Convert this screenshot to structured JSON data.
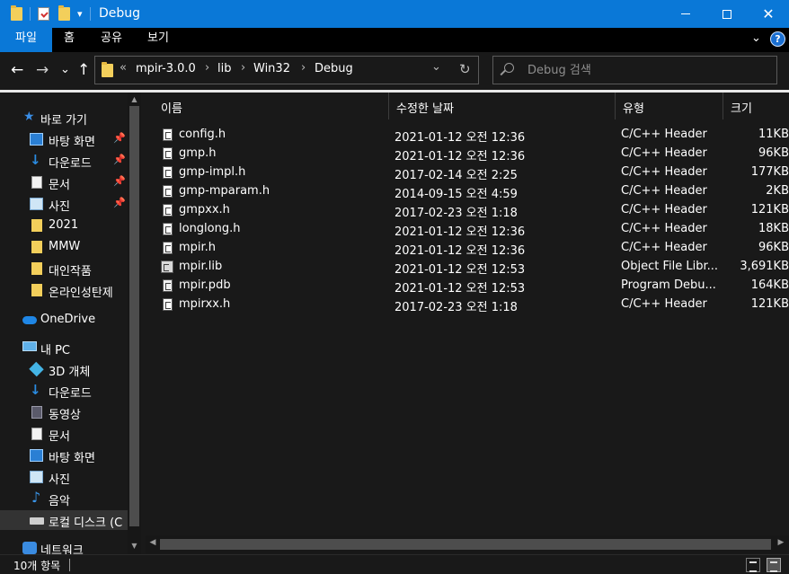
{
  "window": {
    "title": "Debug",
    "minimize_glyph": "—",
    "maximize_glyph": "☐",
    "close_glyph": "✕"
  },
  "ribbon": {
    "tabs": [
      "파일",
      "홈",
      "공유",
      "보기"
    ],
    "collapse_glyph": "⌄",
    "help_glyph": "?"
  },
  "address": {
    "overflow": "«",
    "crumbs": [
      "mpir-3.0.0",
      "lib",
      "Win32",
      "Debug"
    ],
    "separator": "›",
    "dropdown_glyph": "⌄",
    "refresh_glyph": "↻"
  },
  "nav_buttons": {
    "back": "←",
    "forward": "→",
    "recent": "⌄",
    "up": "↑"
  },
  "search": {
    "placeholder": "Debug 검색"
  },
  "navpane": {
    "items": [
      {
        "label": "바로 가기",
        "icon": "star-icon"
      },
      {
        "label": "바탕 화면",
        "icon": "desktop-icon",
        "pinned": true
      },
      {
        "label": "다운로드",
        "icon": "download-icon",
        "pinned": true
      },
      {
        "label": "문서",
        "icon": "document-icon",
        "pinned": true
      },
      {
        "label": "사진",
        "icon": "picture-icon",
        "pinned": true
      },
      {
        "label": "2021",
        "icon": "folder-icon"
      },
      {
        "label": "MMW",
        "icon": "folder-icon"
      },
      {
        "label": "대인작품",
        "icon": "folder-icon"
      },
      {
        "label": "온라인성탄제",
        "icon": "folder-icon"
      },
      {
        "label": "OneDrive",
        "icon": "cloud-icon"
      },
      {
        "label": "내 PC",
        "icon": "computer-icon"
      },
      {
        "label": "3D 개체",
        "icon": "3d-objects-icon"
      },
      {
        "label": "다운로드",
        "icon": "download-icon"
      },
      {
        "label": "동영상",
        "icon": "video-icon"
      },
      {
        "label": "문서",
        "icon": "document-icon"
      },
      {
        "label": "바탕 화면",
        "icon": "desktop-icon"
      },
      {
        "label": "사진",
        "icon": "picture-icon"
      },
      {
        "label": "음악",
        "icon": "music-icon"
      },
      {
        "label": "로컬 디스크 (C",
        "icon": "drive-icon"
      },
      {
        "label": "네트워크",
        "icon": "network-icon"
      }
    ],
    "pin_glyph": "📌"
  },
  "columns": {
    "name": "이름",
    "date": "수정한 날짜",
    "type": "유형",
    "size": "크기",
    "sort_glyph": "^"
  },
  "files": [
    {
      "name": "config.h",
      "date": "2021-01-12 오전 12:36",
      "type": "C/C++ Header",
      "size": "11KB",
      "kind": "header"
    },
    {
      "name": "gmp.h",
      "date": "2021-01-12 오전 12:36",
      "type": "C/C++ Header",
      "size": "96KB",
      "kind": "header"
    },
    {
      "name": "gmp-impl.h",
      "date": "2017-02-14 오전 2:25",
      "type": "C/C++ Header",
      "size": "177KB",
      "kind": "header"
    },
    {
      "name": "gmp-mparam.h",
      "date": "2014-09-15 오전 4:59",
      "type": "C/C++ Header",
      "size": "2KB",
      "kind": "header"
    },
    {
      "name": "gmpxx.h",
      "date": "2017-02-23 오전 1:18",
      "type": "C/C++ Header",
      "size": "121KB",
      "kind": "header"
    },
    {
      "name": "longlong.h",
      "date": "2021-01-12 오전 12:36",
      "type": "C/C++ Header",
      "size": "18KB",
      "kind": "header"
    },
    {
      "name": "mpir.h",
      "date": "2021-01-12 오전 12:36",
      "type": "C/C++ Header",
      "size": "96KB",
      "kind": "header"
    },
    {
      "name": "mpir.lib",
      "date": "2021-01-12 오전 12:53",
      "type": "Object File Libr...",
      "size": "3,691KB",
      "kind": "lib"
    },
    {
      "name": "mpir.pdb",
      "date": "2021-01-12 오전 12:53",
      "type": "Program Debu...",
      "size": "164KB",
      "kind": "pdb"
    },
    {
      "name": "mpirxx.h",
      "date": "2017-02-23 오전 1:18",
      "type": "C/C++ Header",
      "size": "121KB",
      "kind": "header"
    }
  ],
  "statusbar": {
    "count": "10개 항목"
  },
  "scroll_glyphs": {
    "up": "▲",
    "down": "▼",
    "left": "◀",
    "right": "▶"
  }
}
